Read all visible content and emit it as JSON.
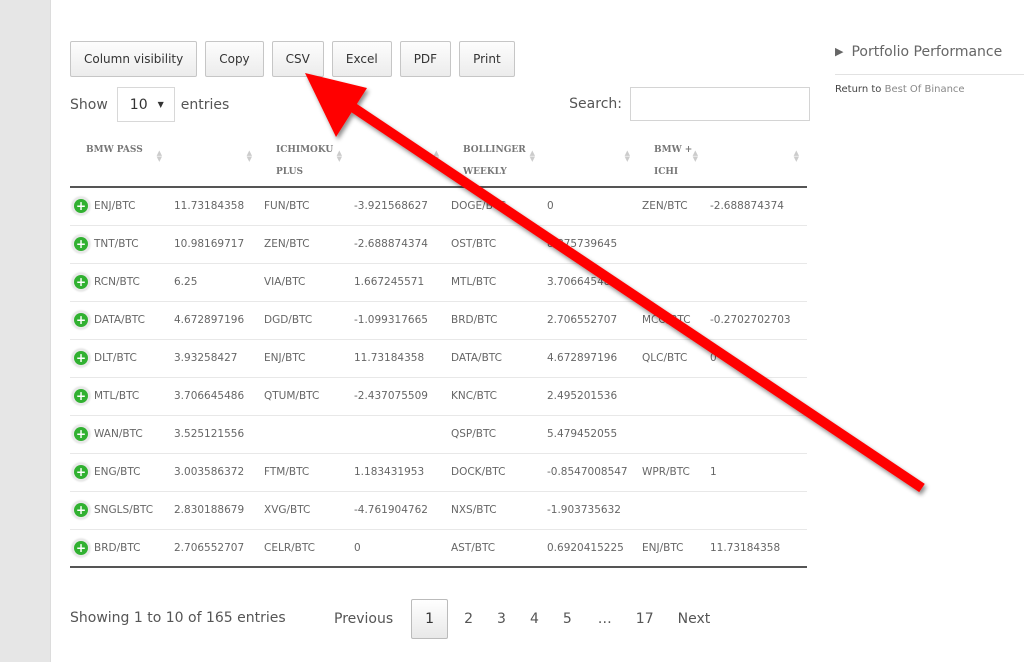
{
  "toolbar": {
    "buttons": [
      "Column visibility",
      "Copy",
      "CSV",
      "Excel",
      "PDF",
      "Print"
    ]
  },
  "length_menu": {
    "prefix": "Show",
    "selected": "10",
    "suffix": "entries"
  },
  "search": {
    "label": "Search:",
    "value": "",
    "placeholder": ""
  },
  "table": {
    "columns": [
      {
        "line1": "BMW PASS",
        "line2": ""
      },
      {
        "line1": "",
        "line2": ""
      },
      {
        "line1": "ICHIMOKU",
        "line2": "PLUS"
      },
      {
        "line1": "",
        "line2": ""
      },
      {
        "line1": "BOLLINGER",
        "line2": "WEEKLY"
      },
      {
        "line1": "",
        "line2": ""
      },
      {
        "line1": "BMW +",
        "line2": "ICHI"
      },
      {
        "line1": "",
        "line2": ""
      }
    ],
    "rows": [
      [
        "ENJ/BTC",
        "11.73184358",
        "FUN/BTC",
        "-3.921568627",
        "DOGE/BTC",
        "0",
        "ZEN/BTC",
        "-2.688874374"
      ],
      [
        "TNT/BTC",
        "10.98169717",
        "ZEN/BTC",
        "-2.688874374",
        "OST/BTC",
        "8.875739645",
        "",
        ""
      ],
      [
        "RCN/BTC",
        "6.25",
        "VIA/BTC",
        "1.667245571",
        "MTL/BTC",
        "3.706645486",
        "",
        ""
      ],
      [
        "DATA/BTC",
        "4.672897196",
        "DGD/BTC",
        "-1.099317665",
        "BRD/BTC",
        "2.706552707",
        "MCO/BTC",
        "-0.2702702703"
      ],
      [
        "DLT/BTC",
        "3.93258427",
        "ENJ/BTC",
        "11.73184358",
        "DATA/BTC",
        "4.672897196",
        "QLC/BTC",
        "0"
      ],
      [
        "MTL/BTC",
        "3.706645486",
        "QTUM/BTC",
        "-2.437075509",
        "KNC/BTC",
        "2.495201536",
        "",
        ""
      ],
      [
        "WAN/BTC",
        "3.525121556",
        "",
        "",
        "QSP/BTC",
        "5.479452055",
        "",
        ""
      ],
      [
        "ENG/BTC",
        "3.003586372",
        "FTM/BTC",
        "1.183431953",
        "DOCK/BTC",
        "-0.8547008547",
        "WPR/BTC",
        "1"
      ],
      [
        "SNGLS/BTC",
        "2.830188679",
        "XVG/BTC",
        "-4.761904762",
        "NXS/BTC",
        "-1.903735632",
        "",
        ""
      ],
      [
        "BRD/BTC",
        "2.706552707",
        "CELR/BTC",
        "0",
        "AST/BTC",
        "0.6920415225",
        "ENJ/BTC",
        "11.73184358"
      ]
    ]
  },
  "footer": {
    "info": "Showing 1 to 10 of 165 entries",
    "previous": "Previous",
    "pages": [
      "1",
      "2",
      "3",
      "4",
      "5"
    ],
    "ellipsis": "…",
    "last_page": "17",
    "next": "Next",
    "current_page": "1"
  },
  "sidebar": {
    "title": "Portfolio Performance",
    "return_prefix": "Return to",
    "return_link": "Best Of Binance"
  },
  "annotation": {
    "type": "red-arrow",
    "points_to": "CSV",
    "color": "#ff0000"
  },
  "colors": {
    "expand_icon": "#31b131",
    "gutter": "#e6e6e6"
  }
}
